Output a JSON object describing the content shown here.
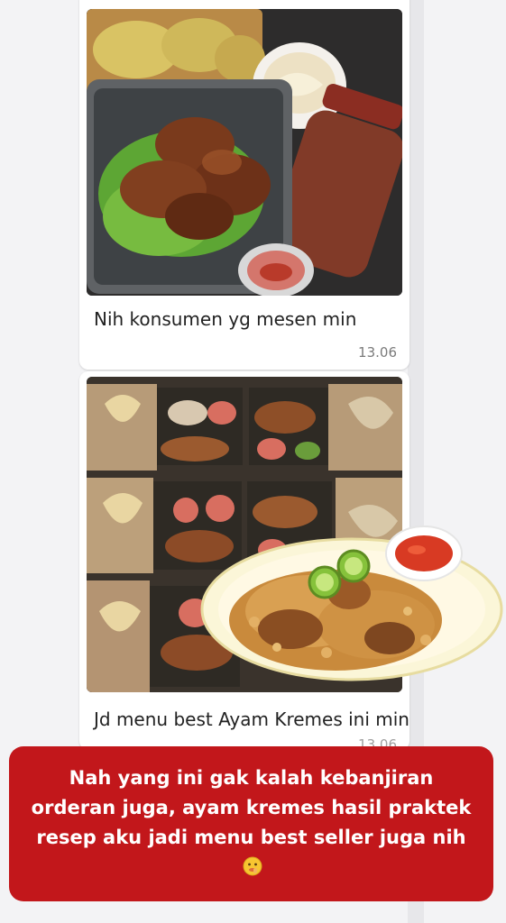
{
  "messages": [
    {
      "caption": "Nih konsumen yg mesen min",
      "time": "13.06",
      "photo": "fried chicken in container with sambal"
    },
    {
      "caption": "Jd menu best Ayam Kremes ini min",
      "time": "13.06",
      "photo": "boxed ayam kremes orders"
    }
  ],
  "overlay": {
    "image": "ayam kremes plate with lime and sambal"
  },
  "banner": {
    "text": "Nah yang ini gak kalah kebanjiran orderan juga, ayam kremes hasil praktek resep aku jadi menu best seller juga nih",
    "emoji": "shushing-face-emoji",
    "color": "#c2171b"
  }
}
